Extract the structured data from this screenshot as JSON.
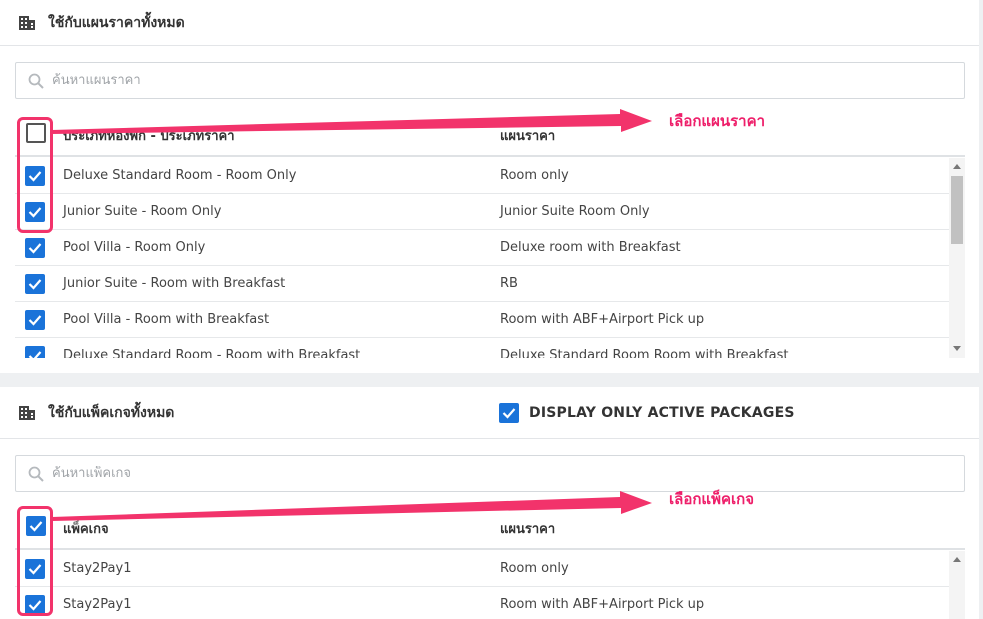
{
  "rate_plans_section": {
    "title": "ใช้กับแผนราคาทั้งหมด",
    "search_placeholder": "ค้นหาแผนราคา",
    "columns": [
      "ประเภทห้องพัก - ประเภทราคา",
      "แผนราคา"
    ],
    "header_checkbox_checked": false,
    "rows": [
      {
        "room": "Deluxe Standard Room - Room Only",
        "plan": "Room only",
        "checked": true
      },
      {
        "room": "Junior Suite - Room Only",
        "plan": "Junior Suite Room Only",
        "checked": true
      },
      {
        "room": "Pool Villa - Room Only",
        "plan": "Deluxe room with Breakfast",
        "checked": true
      },
      {
        "room": "Junior Suite - Room with Breakfast",
        "plan": "RB",
        "checked": true
      },
      {
        "room": "Pool Villa - Room with Breakfast",
        "plan": "Room with ABF+Airport Pick up",
        "checked": true
      },
      {
        "room": "Deluxe Standard Room - Room with Breakfast",
        "plan": "Deluxe Standard Room Room with Breakfast",
        "checked": true
      }
    ],
    "annotation": "เลือกแผนราคา"
  },
  "packages_section": {
    "title": "ใช้กับแพ็คเกจทั้งหมด",
    "active_only_label": "DISPLAY ONLY ACTIVE PACKAGES",
    "active_only_checked": true,
    "search_placeholder": "ค้นหาแพ็คเกจ",
    "columns": [
      "แพ็คเกจ",
      "แผนราคา"
    ],
    "header_checkbox_checked": true,
    "rows": [
      {
        "package": "Stay2Pay1",
        "plan": "Room only",
        "checked": true
      },
      {
        "package": "Stay2Pay1",
        "plan": "Room with ABF+Airport Pick up",
        "checked": true
      }
    ],
    "annotation": "เลือกแพ็คเกจ"
  },
  "colors": {
    "checkbox": "#1a73d9",
    "annotation": "#ee1f6a",
    "highlight": "#f2336b"
  },
  "icons": [
    "building-icon",
    "search-icon",
    "checkmark-icon",
    "scroll-up-arrow-icon",
    "scroll-down-arrow-icon",
    "annotation-arrow"
  ]
}
